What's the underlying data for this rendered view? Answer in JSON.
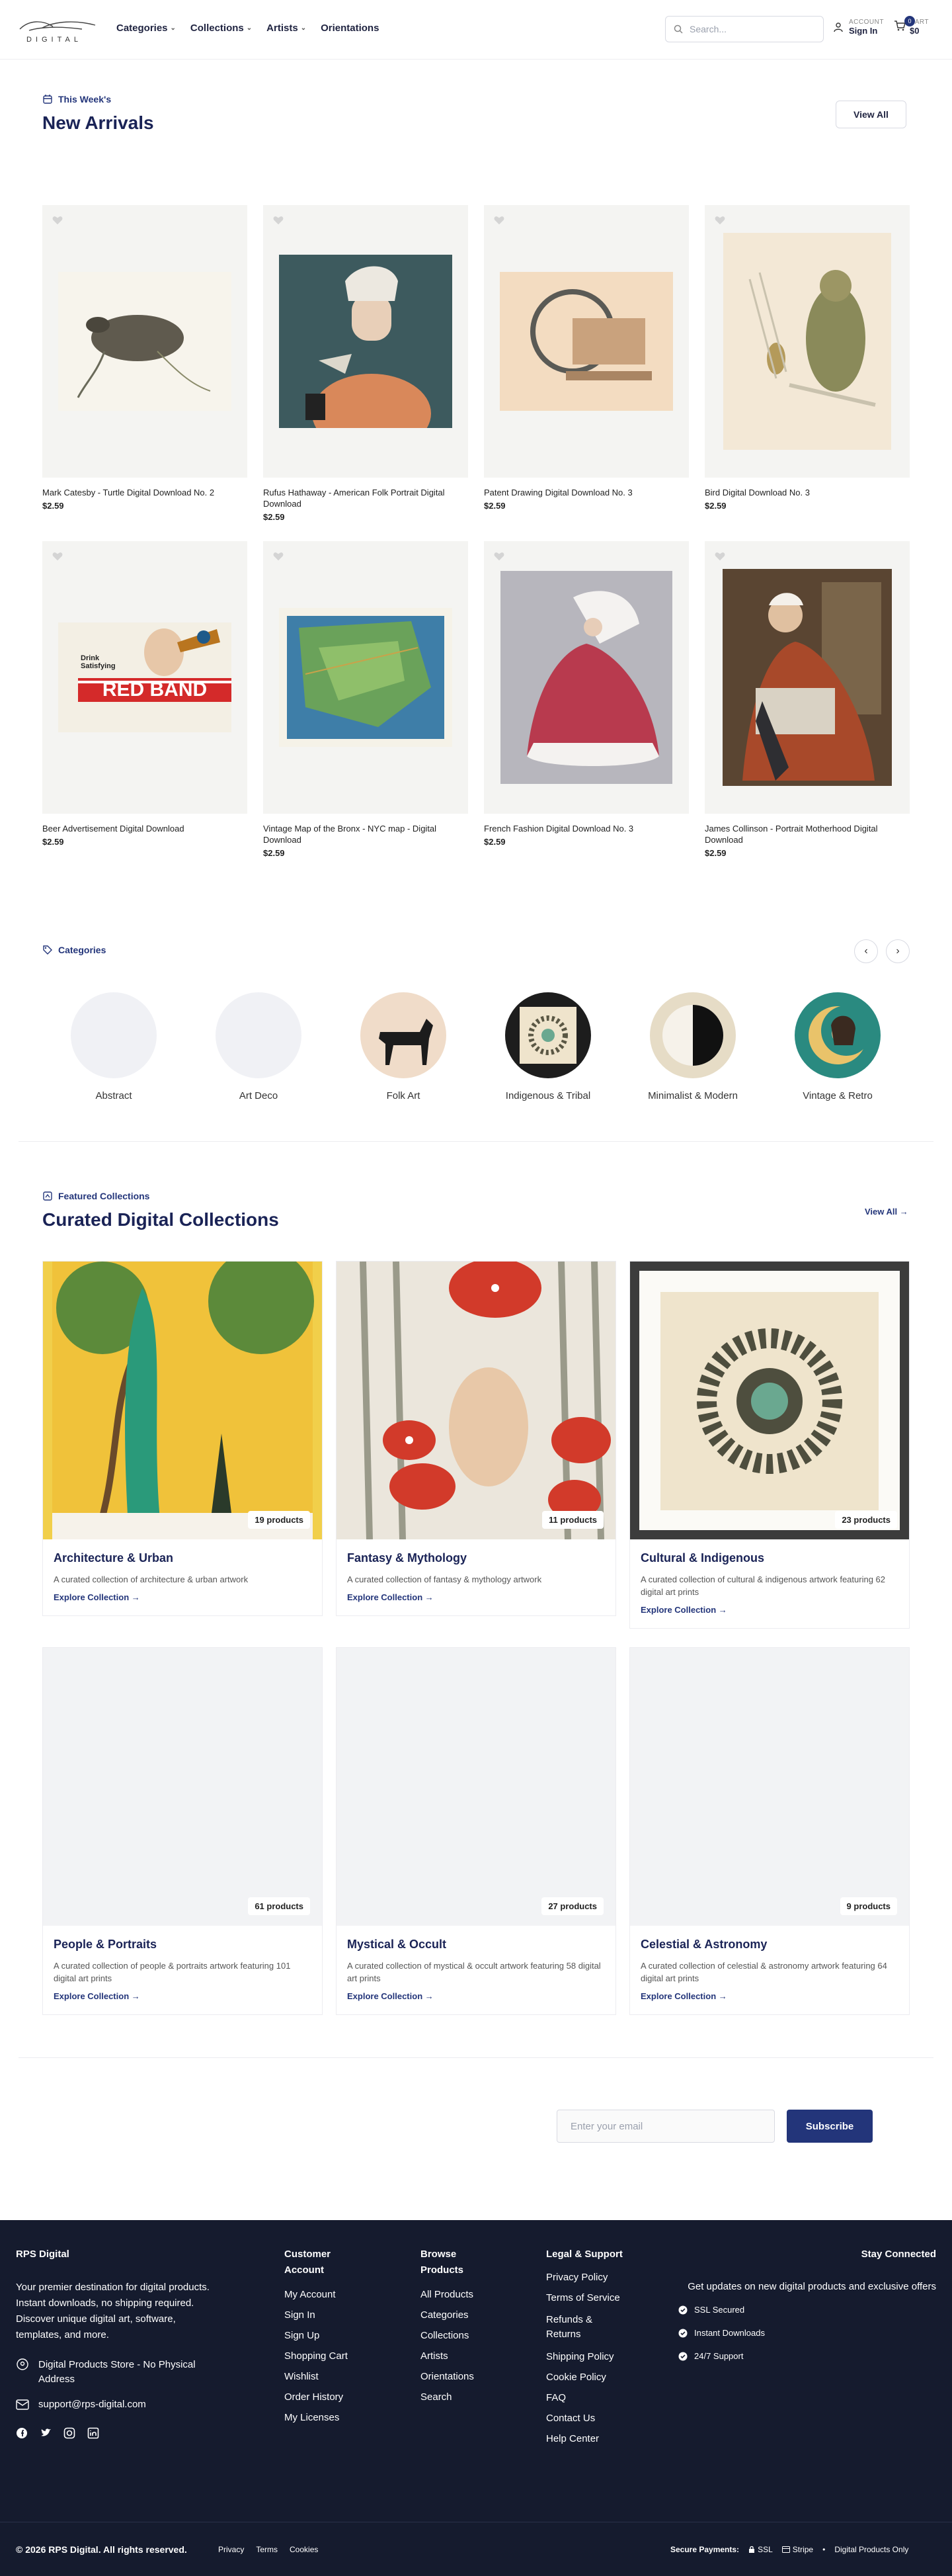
{
  "brand": {
    "logo_text": "DIGITAL",
    "name": "RPS Digital"
  },
  "nav": {
    "items": [
      {
        "label": "Categories",
        "dropdown": true
      },
      {
        "label": "Collections",
        "dropdown": true
      },
      {
        "label": "Artists",
        "dropdown": true
      },
      {
        "label": "Orientations",
        "dropdown": false
      }
    ]
  },
  "search": {
    "placeholder": "Search..."
  },
  "account": {
    "label": "ACCOUNT",
    "value": "Sign In"
  },
  "cart": {
    "label": "CART",
    "value": "$0",
    "count": "0"
  },
  "new_arrivals": {
    "eyebrow": "This Week's",
    "title": "New Arrivals",
    "view_all": "View All",
    "products": [
      {
        "title": "Mark Catesby - Turtle Digital Download No. 2",
        "price": "$2.59"
      },
      {
        "title": "Rufus Hathaway - American Folk Portrait Digital Download",
        "price": "$2.59"
      },
      {
        "title": "Patent Drawing Digital Download No. 3",
        "price": "$2.59"
      },
      {
        "title": "Bird Digital Download No. 3",
        "price": "$2.59"
      },
      {
        "title": "Beer Advertisement Digital Download",
        "price": "$2.59"
      },
      {
        "title": "Vintage Map of the Bronx - NYC map - Digital Download",
        "price": "$2.59"
      },
      {
        "title": "French Fashion Digital Download No. 3",
        "price": "$2.59"
      },
      {
        "title": "James Collinson - Portrait Motherhood Digital Download",
        "price": "$2.59"
      }
    ],
    "beer_ad": {
      "line1": "Drink",
      "line2": "Satisfying",
      "band": "RED BAND"
    }
  },
  "categories": {
    "title": "Categories",
    "items": [
      "Abstract",
      "Art Deco",
      "Folk Art",
      "Indigenous & Tribal",
      "Minimalist & Modern",
      "Vintage & Retro"
    ]
  },
  "collections": {
    "eyebrow": "Featured Collections",
    "title": "Curated Digital Collections",
    "view_all": "View All →",
    "items": [
      {
        "title": "Architecture & Urban",
        "count": "19 products",
        "desc": "A curated collection of architecture & urban artwork",
        "link": "Explore Collection →"
      },
      {
        "title": "Fantasy & Mythology",
        "count": "11 products",
        "desc": "A curated collection of fantasy & mythology artwork",
        "link": "Explore Collection →"
      },
      {
        "title": "Cultural & Indigenous",
        "count": "23 products",
        "desc": "A curated collection of cultural & indigenous artwork featuring 62 digital art prints",
        "link": "Explore Collection →"
      },
      {
        "title": "People & Portraits",
        "count": "61 products",
        "desc": "A curated collection of people & portraits artwork featuring 101 digital art prints",
        "link": "Explore Collection →"
      },
      {
        "title": "Mystical & Occult",
        "count": "27 products",
        "desc": "A curated collection of mystical & occult artwork featuring 58 digital art prints",
        "link": "Explore Collection →"
      },
      {
        "title": "Celestial & Astronomy",
        "count": "9 products",
        "desc": "A curated collection of celestial & astronomy artwork featuring 64 digital art prints",
        "link": "Explore Collection →"
      }
    ]
  },
  "newsletter": {
    "placeholder": "Enter your email",
    "button": "Subscribe"
  },
  "footer": {
    "brand": "RPS Digital",
    "tagline": "Your premier destination for digital products. Instant downloads, no shipping required. Discover unique digital art, software, templates, and more.",
    "address": "Digital Products Store - No Physical Address",
    "email": "support@rps-digital.com",
    "account": {
      "title": "Customer Account",
      "links": [
        "My Account",
        "Sign In",
        "Sign Up",
        "Shopping Cart",
        "Wishlist",
        "Order History",
        "My Licenses"
      ]
    },
    "browse": {
      "title": "Browse Products",
      "links": [
        "All Products",
        "Categories",
        "Collections",
        "Artists",
        "Orientations",
        "Search"
      ]
    },
    "legal": {
      "title": "Legal & Support",
      "links": [
        "Privacy Policy",
        "Terms of Service",
        "Refunds & Returns",
        "Shipping Policy",
        "Cookie Policy",
        "FAQ",
        "Contact Us",
        "Help Center"
      ]
    },
    "stay": {
      "title": "Stay Connected",
      "text": "Get updates on new digital products and exclusive offers",
      "badges": [
        "SSL Secured",
        "Instant Downloads",
        "24/7 Support"
      ]
    },
    "copyright": "© 2026 RPS Digital. All rights reserved.",
    "bottom_links": [
      "Privacy",
      "Terms",
      "Cookies"
    ],
    "secure_label": "Secure Payments:",
    "secure_items": [
      "SSL",
      "Stripe",
      "Digital Products Only"
    ]
  },
  "colors": {
    "primary": "#23357a",
    "footer_bg": "#151b2e",
    "card_bg": "#f4f4f2"
  }
}
